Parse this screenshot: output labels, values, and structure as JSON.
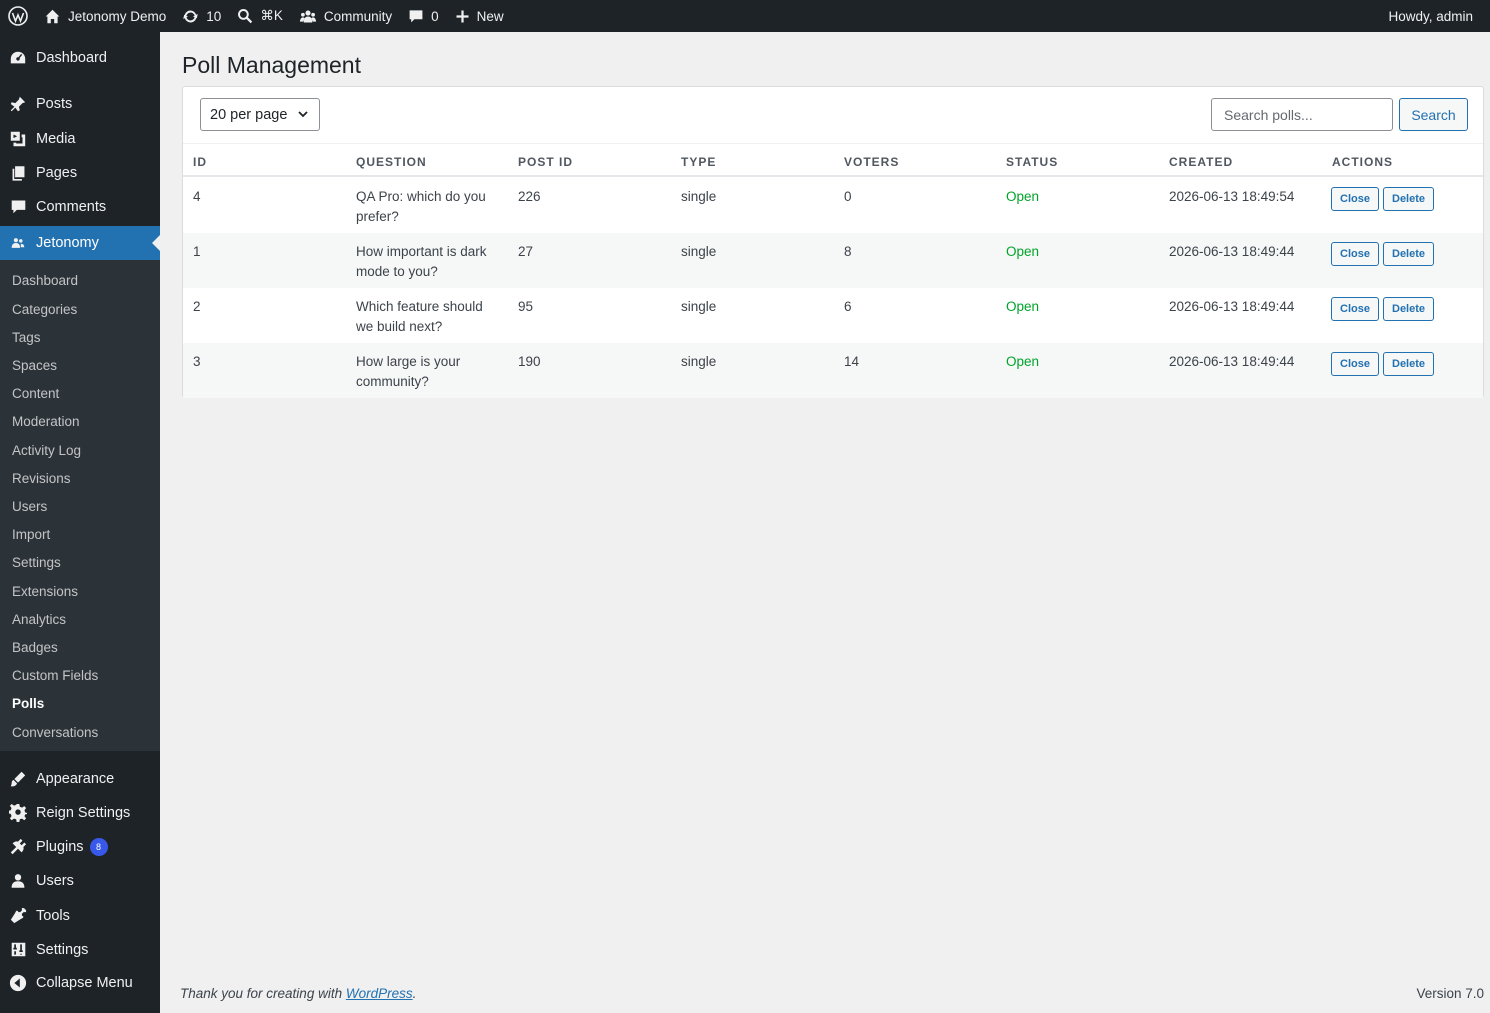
{
  "adminbar": {
    "site_name": "Jetonomy Demo",
    "updates_count": "10",
    "search_shortcut": "⌘K",
    "community_label": "Community",
    "comments_count": "0",
    "new_label": "New",
    "howdy": "Howdy, admin"
  },
  "sidebar": {
    "dashboard": "Dashboard",
    "posts": "Posts",
    "media": "Media",
    "pages": "Pages",
    "comments": "Comments",
    "jetonomy": "Jetonomy",
    "submenu": [
      "Dashboard",
      "Categories",
      "Tags",
      "Spaces",
      "Content",
      "Moderation",
      "Activity Log",
      "Revisions",
      "Users",
      "Import",
      "Settings",
      "Extensions",
      "Analytics",
      "Badges",
      "Custom Fields",
      "Polls",
      "Conversations"
    ],
    "appearance": "Appearance",
    "reign_settings": "Reign Settings",
    "plugins": "Plugins",
    "plugins_badge": "8",
    "users": "Users",
    "tools": "Tools",
    "settings": "Settings",
    "collapse": "Collapse Menu"
  },
  "page": {
    "title": "Poll Management",
    "per_page": "20 per page",
    "search_placeholder": "Search polls...",
    "search_button": "Search"
  },
  "table": {
    "headers": [
      "ID",
      "QUESTION",
      "POST ID",
      "TYPE",
      "VOTERS",
      "STATUS",
      "CREATED",
      "ACTIONS"
    ],
    "close_label": "Close",
    "delete_label": "Delete",
    "rows": [
      {
        "id": "4",
        "question": "QA Pro: which do you prefer?",
        "post_id": "226",
        "type": "single",
        "voters": "0",
        "status": "Open",
        "created": "2026-06-13 18:49:54"
      },
      {
        "id": "1",
        "question": "How important is dark mode to you?",
        "post_id": "27",
        "type": "single",
        "voters": "8",
        "status": "Open",
        "created": "2026-06-13 18:49:44"
      },
      {
        "id": "2",
        "question": "Which feature should we build next?",
        "post_id": "95",
        "type": "single",
        "voters": "6",
        "status": "Open",
        "created": "2026-06-13 18:49:44"
      },
      {
        "id": "3",
        "question": "How large is your community?",
        "post_id": "190",
        "type": "single",
        "voters": "14",
        "status": "Open",
        "created": "2026-06-13 18:49:44"
      }
    ]
  },
  "footer": {
    "thanks_prefix": "Thank you for creating with ",
    "wordpress_link": "WordPress",
    "thanks_suffix": ".",
    "version": "Version 7.0"
  },
  "colors": {
    "accent": "#2271b1",
    "status_open": "#00a32a",
    "adminbar_bg": "#1d2327",
    "badge": "#3858e9"
  }
}
